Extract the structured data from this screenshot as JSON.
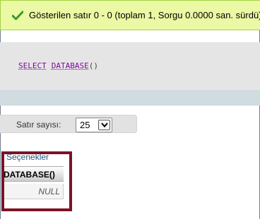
{
  "success_message": {
    "text": "Gösterilen satır 0 - 0 (toplam 1, Sorgu 0.0000 san. sürdü)",
    "icon": "check-icon"
  },
  "sql": {
    "keyword": "SELECT",
    "function": "DATABASE",
    "parens": "()"
  },
  "navigation": {
    "rows_label": "Satır sayısı:",
    "rows_value": "25"
  },
  "results": {
    "options_link": "Seçenekler",
    "columns": [
      "DATABASE()"
    ],
    "rows": [
      [
        "NULL"
      ]
    ]
  },
  "colors": {
    "success_bg": "#ebf8a4",
    "sql_keyword": "#7f0aa1",
    "highlight": "#7a1326",
    "link": "#235a81"
  }
}
